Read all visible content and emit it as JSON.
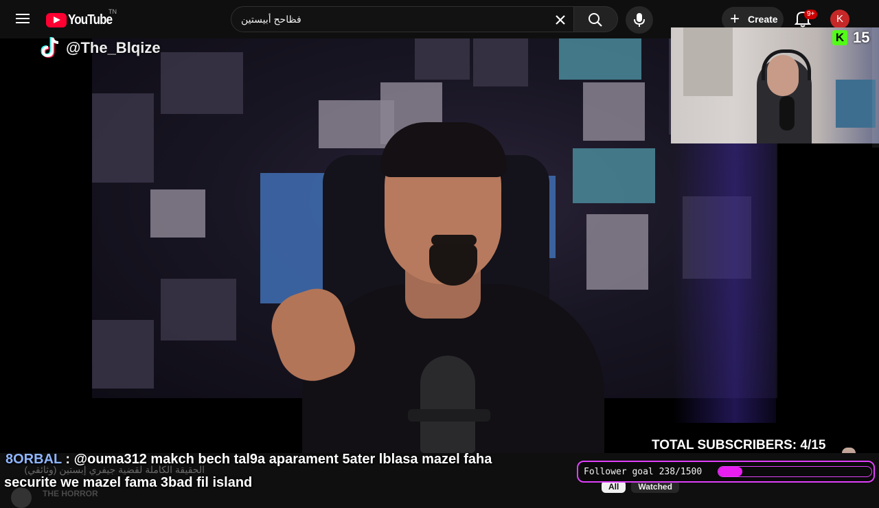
{
  "youtube": {
    "logo_text": "YouTube",
    "logo_tm": "TN",
    "search_query": "فظاحح أبيستين",
    "create_label": "Create",
    "notification_badge": "9+",
    "avatar_letter": "K",
    "brand_red": "#ff0033"
  },
  "overlay": {
    "tiktok_handle": "@The_Blqize",
    "kick_count": "15",
    "kick_letter": "K",
    "kick_color": "#53fc18",
    "subscribers_text": "TOTAL SUBSCRIBERS: 4/15"
  },
  "chat": {
    "username": "8ORBAL",
    "separator": " : ",
    "message_line1": "@ouma312 makch bech tal9a aparament 5ater lblasa mazel faha",
    "message_line2": "securite we mazel fama 3bad fil island"
  },
  "follower_goal": {
    "label": "Follower goal 238/1500",
    "current": 238,
    "target": 1500,
    "accent": "#e040fb"
  },
  "behind": {
    "video_title": "الحقيقة الكاملة لقضية جيفري إبستين (وثائقي)",
    "channel_name": "THE HORROR",
    "chips": [
      "All",
      "Watched"
    ]
  }
}
